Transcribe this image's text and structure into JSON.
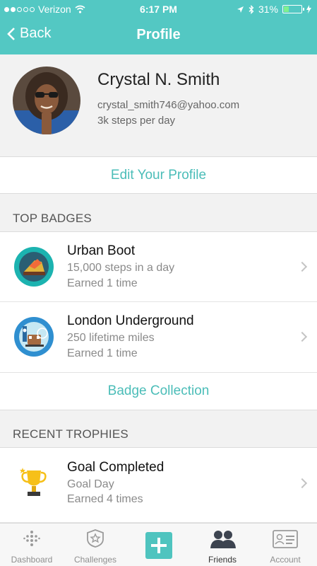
{
  "status_bar": {
    "carrier": "Verizon",
    "time": "6:17 PM",
    "battery": "31%",
    "battery_level": 0.31
  },
  "nav": {
    "back_label": "Back",
    "title": "Profile"
  },
  "profile": {
    "name": "Crystal N. Smith",
    "email": "crystal_smith746@yahoo.com",
    "steps": "3k steps per day"
  },
  "edit_profile_label": "Edit Your Profile",
  "top_badges": {
    "heading": "TOP BADGES",
    "items": [
      {
        "title": "Urban Boot",
        "subtitle": "15,000 steps in a day",
        "earned": "Earned 1 time",
        "icon": "urban-boot-badge-icon"
      },
      {
        "title": "London Underground",
        "subtitle": "250 lifetime miles",
        "earned": "Earned 1 time",
        "icon": "london-underground-badge-icon"
      }
    ],
    "collection_label": "Badge Collection"
  },
  "recent_trophies": {
    "heading": "RECENT TROPHIES",
    "items": [
      {
        "title": "Goal Completed",
        "subtitle": "Goal Day",
        "earned": "Earned 4 times",
        "icon": "trophy-icon"
      }
    ]
  },
  "tabs": [
    {
      "label": "Dashboard",
      "icon": "dashboard-icon"
    },
    {
      "label": "Challenges",
      "icon": "challenges-icon"
    },
    {
      "label": "",
      "icon": "add-icon"
    },
    {
      "label": "Friends",
      "icon": "friends-icon",
      "active": true
    },
    {
      "label": "Account",
      "icon": "account-icon"
    }
  ],
  "colors": {
    "teal": "#53c8c3",
    "link_teal": "#4bbdb8"
  }
}
